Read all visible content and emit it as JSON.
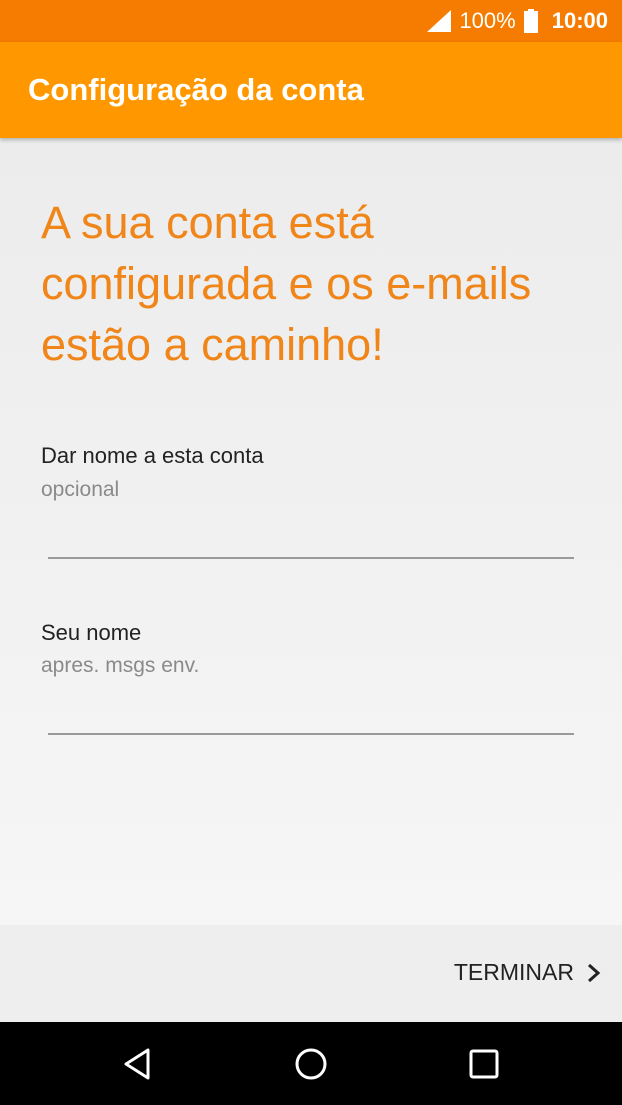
{
  "status_bar": {
    "battery_percent": "100%",
    "time": "10:00",
    "signal_icon": "signal-full-icon",
    "battery_icon": "battery-full-icon"
  },
  "app_bar": {
    "title": "Configuração da conta"
  },
  "main": {
    "headline": "A sua conta está configurada e os e-mails estão a caminho!",
    "fields": [
      {
        "label": "Dar nome a esta conta",
        "hint": "opcional",
        "value": ""
      },
      {
        "label": "Seu nome",
        "hint": "apres. msgs env.",
        "value": ""
      }
    ]
  },
  "footer": {
    "finish_label": "TERMINAR",
    "finish_icon": "chevron-right-icon"
  },
  "nav_bar": {
    "icons": [
      "back-icon",
      "home-icon",
      "recents-icon"
    ]
  },
  "colors": {
    "status_bar": "#f57c00",
    "app_bar": "#ff9800",
    "headline": "#f08519"
  }
}
